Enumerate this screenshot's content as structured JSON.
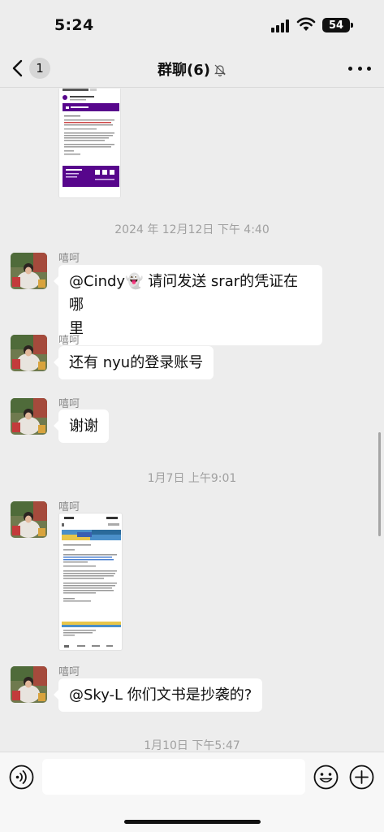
{
  "status_bar": {
    "time": "5:24",
    "battery": "54"
  },
  "nav": {
    "back_badge": "1",
    "title": "群聊(6)"
  },
  "messages": [
    {
      "type": "timestamp",
      "text": "2024 年 12月12日 下午 4:40"
    },
    {
      "sender": "嘻呵",
      "text_lines": [
        "@Cindy👻 请问发送 srar的凭证在哪",
        "里"
      ]
    },
    {
      "sender": "嘻呵",
      "text": "还有 nyu的登录账号"
    },
    {
      "sender": "嘻呵",
      "text": "谢谢"
    },
    {
      "type": "timestamp",
      "text": "1月7日 上午9:01"
    },
    {
      "sender": "嘻呵",
      "type": "image"
    },
    {
      "sender": "嘻呵",
      "text": "@Sky-L 你们文书是抄袭的?"
    },
    {
      "type": "timestamp",
      "text": "1月10日 下午5:47"
    }
  ],
  "first_image": {
    "title": "Incomplete",
    "badge": "Inbox",
    "from": "New York Univer...",
    "banner": "New York University"
  },
  "second_image": {
    "time": "9:00",
    "date": "Tuesday, January 7, 2025"
  },
  "colors": {
    "background": "#ededed",
    "bubble": "#ffffff",
    "nyu_purple": "#57068c",
    "timestamp": "#a0a0a0"
  },
  "icons": [
    "back-chevron-icon",
    "mute-bell-icon",
    "more-dots-icon",
    "voice-icon",
    "emoji-icon",
    "plus-icon"
  ]
}
